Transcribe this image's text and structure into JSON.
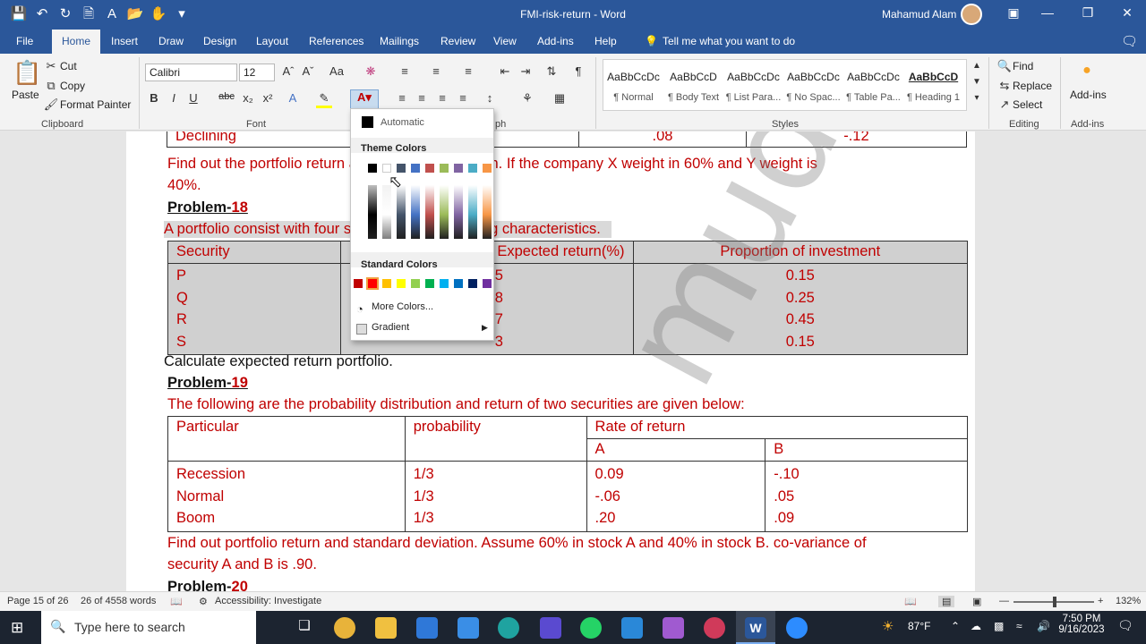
{
  "window": {
    "title": "FMI-risk-return - Word",
    "user": "Mahamud Alam"
  },
  "tabs": [
    "File",
    "Home",
    "Insert",
    "Draw",
    "Design",
    "Layout",
    "References",
    "Mailings",
    "Review",
    "View",
    "Add-ins",
    "Help"
  ],
  "tell_me": "Tell me what you want to do",
  "clipboard": {
    "paste": "Paste",
    "cut": "Cut",
    "copy": "Copy",
    "format_painter": "Format Painter",
    "label": "Clipboard"
  },
  "font": {
    "name": "Calibri",
    "size": "12",
    "label": "Font"
  },
  "paragraph": {
    "label": "ph"
  },
  "styles": {
    "label": "Styles",
    "items": [
      {
        "preview": "AaBbCcDc",
        "name": "¶ Normal"
      },
      {
        "preview": "AaBbCcD",
        "name": "¶ Body Text"
      },
      {
        "preview": "AaBbCcDc",
        "name": "¶ List Para..."
      },
      {
        "preview": "AaBbCcDc",
        "name": "¶ No Spac..."
      },
      {
        "preview": "AaBbCcDc",
        "name": "¶ Table Pa..."
      },
      {
        "preview": "AaBbCcD",
        "name": "¶ Heading 1"
      }
    ]
  },
  "editing": {
    "find": "Find",
    "replace": "Replace",
    "select": "Select",
    "label": "Editing"
  },
  "addins": {
    "button": "Add-ins",
    "label": "Add-ins"
  },
  "color_menu": {
    "automatic": "Automatic",
    "theme": "Theme Colors",
    "standard": "Standard Colors",
    "more": "More Colors...",
    "gradient": "Gradient",
    "theme_top": [
      "#000000",
      "#ffffff",
      "#44546a",
      "#4472c4",
      "#c0504d",
      "#9bbb59",
      "#8064a2",
      "#4bacc6",
      "#f79646"
    ],
    "standard_colors": [
      "#c00000",
      "#ff0000",
      "#ffc000",
      "#ffff00",
      "#92d050",
      "#00b050",
      "#00b0f0",
      "#0070c0",
      "#002060",
      "#7030a0"
    ]
  },
  "document": {
    "line_declining": "Declining",
    "val1": ".08",
    "val2": "-.12",
    "p17_line1": "Find out the portfolio return and standard deviation. If the company X weight in 60% and Y weight is",
    "p17_line2": "40%.",
    "h18_word": "Problem-",
    "h18_num": "18",
    "p18_intro": "A portfolio consist with four securities with following characteristics.",
    "t18_headers": [
      "Security",
      "Expected return(%)",
      "Proportion of investment"
    ],
    "t18_rows": [
      [
        "P",
        "5",
        "0.15"
      ],
      [
        "Q",
        "8",
        "0.25"
      ],
      [
        "R",
        "7",
        "0.45"
      ],
      [
        "S",
        "3",
        "0.15"
      ]
    ],
    "p18_calc": "Calculate expected return portfolio.",
    "h19_word": "Problem-",
    "h19_num": "19",
    "p19_intro": "The following are the probability distribution and return of two securities are given below:",
    "t19_h": [
      "Particular",
      "probability",
      "Rate of return",
      "A",
      "B"
    ],
    "t19_col1": [
      "Recession",
      "Normal",
      "Boom"
    ],
    "t19_col2": [
      "1/3",
      "1/3",
      "1/3"
    ],
    "t19_col3": [
      "0.09",
      "-.06",
      ".20"
    ],
    "t19_col4": [
      "-.10",
      ".05",
      ".09"
    ],
    "p19_line1": "Find out portfolio return and standard deviation. Assume 60% in stock A and 40% in stock B. co-variance of",
    "p19_line2": "security A and B is .90.",
    "h20_word": "Problem-",
    "h20_num": "20",
    "watermark": "mudalam"
  },
  "status": {
    "page": "Page 15 of 26",
    "words": "26 of 4558 words",
    "accessibility": "Accessibility: Investigate",
    "zoom": "132%"
  },
  "taskbar": {
    "search": "Type here to search",
    "temp": "87°F",
    "time": "7:50 PM",
    "date": "9/16/2023"
  }
}
